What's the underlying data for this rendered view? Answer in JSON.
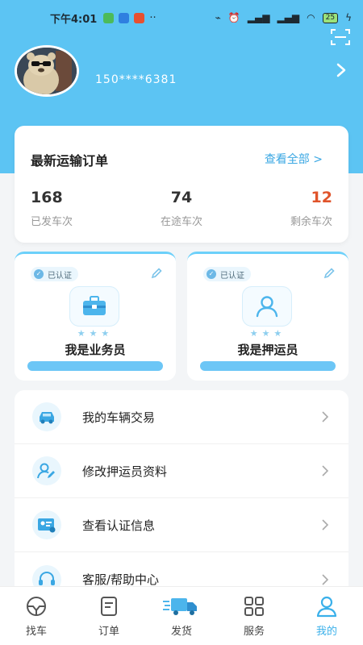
{
  "status_bar": {
    "time": "下午4:01",
    "extra": "··",
    "battery": "25"
  },
  "profile": {
    "phone": "150****6381"
  },
  "orders": {
    "title": "最新运输订单",
    "view_all": "查看全部 >",
    "stats": [
      {
        "value": "168",
        "label": "已发车次",
        "color": "#333333"
      },
      {
        "value": "74",
        "label": "在途车次",
        "color": "#333333"
      },
      {
        "value": "12",
        "label": "剩余车次",
        "color": "#e0542b"
      }
    ]
  },
  "roles": [
    {
      "badge": "已认证",
      "title": "我是业务员",
      "icon": "briefcase-icon"
    },
    {
      "badge": "已认证",
      "title": "我是押运员",
      "icon": "person-icon"
    }
  ],
  "menu": [
    {
      "label": "我的车辆交易",
      "icon": "car-icon"
    },
    {
      "label": "修改押运员资料",
      "icon": "user-edit-icon"
    },
    {
      "label": "查看认证信息",
      "icon": "id-card-icon"
    },
    {
      "label": "客服/帮助中心",
      "icon": "headset-icon"
    }
  ],
  "tabs": [
    {
      "label": "找车",
      "icon": "steering-wheel-icon"
    },
    {
      "label": "订单",
      "icon": "document-icon"
    },
    {
      "label": "发货",
      "icon": "truck-icon"
    },
    {
      "label": "服务",
      "icon": "grid-icon"
    },
    {
      "label": "我的",
      "icon": "user-icon",
      "active": true
    }
  ],
  "colors": {
    "header": "#5cc4f3",
    "accent": "#3ab0ea",
    "remaining": "#e0542b"
  }
}
